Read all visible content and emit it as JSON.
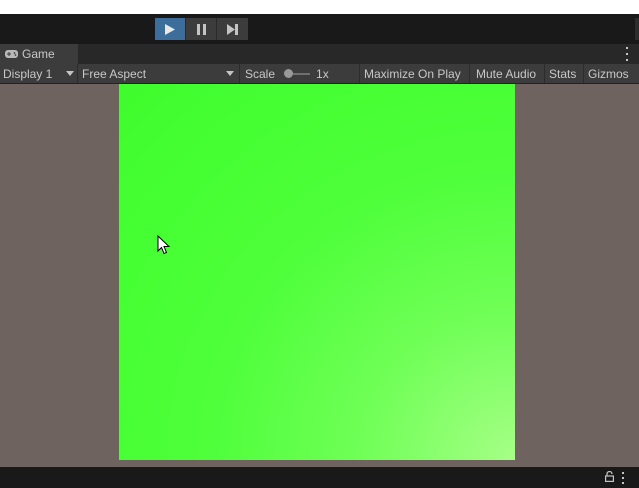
{
  "toolbar": {
    "play_icon": "play-icon",
    "pause_icon": "pause-icon",
    "step_icon": "step-icon"
  },
  "tab": {
    "label": "Game",
    "icon": "gamepad-icon"
  },
  "game_toolbar": {
    "display": "Display 1",
    "aspect": "Free Aspect",
    "scale_label": "Scale",
    "scale_value": "1x",
    "maximize": "Maximize On Play",
    "mute": "Mute Audio",
    "stats": "Stats",
    "gizmos": "Gizmos"
  },
  "colors": {
    "play_active": "#3d6d9b",
    "game_background": "#45ff32",
    "viewport_background": "#6f6360"
  }
}
